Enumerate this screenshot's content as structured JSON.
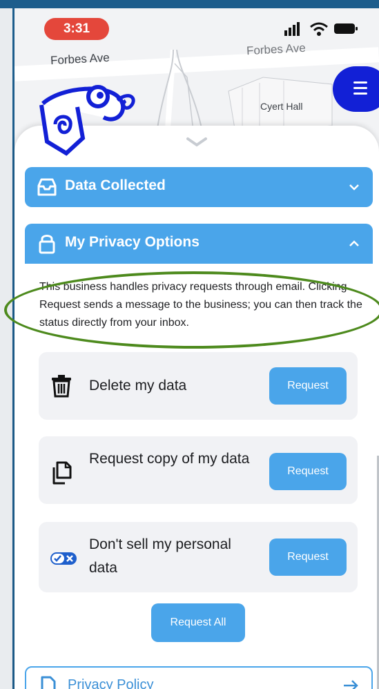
{
  "status_bar": {
    "time": "3:31",
    "icons": [
      "signal-icon",
      "wifi-icon",
      "battery-icon"
    ]
  },
  "map": {
    "labels": {
      "street_left": "Forbes Ave",
      "street_right": "Forbes Ave",
      "building": "Cyert Hall"
    }
  },
  "colors": {
    "accent": "#4aa5ea",
    "menu": "#1220d6",
    "time_pill": "#e4473b",
    "highlight_oval": "#4d8a1d"
  },
  "sections": {
    "data_collected": {
      "label": "Data Collected",
      "icon": "inbox-tray-icon",
      "chevron": "chevron-down-icon"
    },
    "privacy_options": {
      "label": "My Privacy Options",
      "icon": "lock-icon",
      "chevron": "chevron-up-icon"
    }
  },
  "description": "This business handles privacy requests through email. Clicking Request sends a message to the business; you can then track the status directly from your inbox.",
  "options": [
    {
      "label": "Delete my data",
      "icon": "trash-icon",
      "button": "Request"
    },
    {
      "label": "Request copy of my data",
      "icon": "copy-document-icon",
      "button": "Request"
    },
    {
      "label": "Don't sell my personal data",
      "icon": "opt-out-toggle-icon",
      "button": "Request"
    }
  ],
  "request_all": "Request All",
  "privacy_policy": {
    "label": "Privacy Policy",
    "icon": "document-icon",
    "arrow": "arrow-right-icon"
  }
}
